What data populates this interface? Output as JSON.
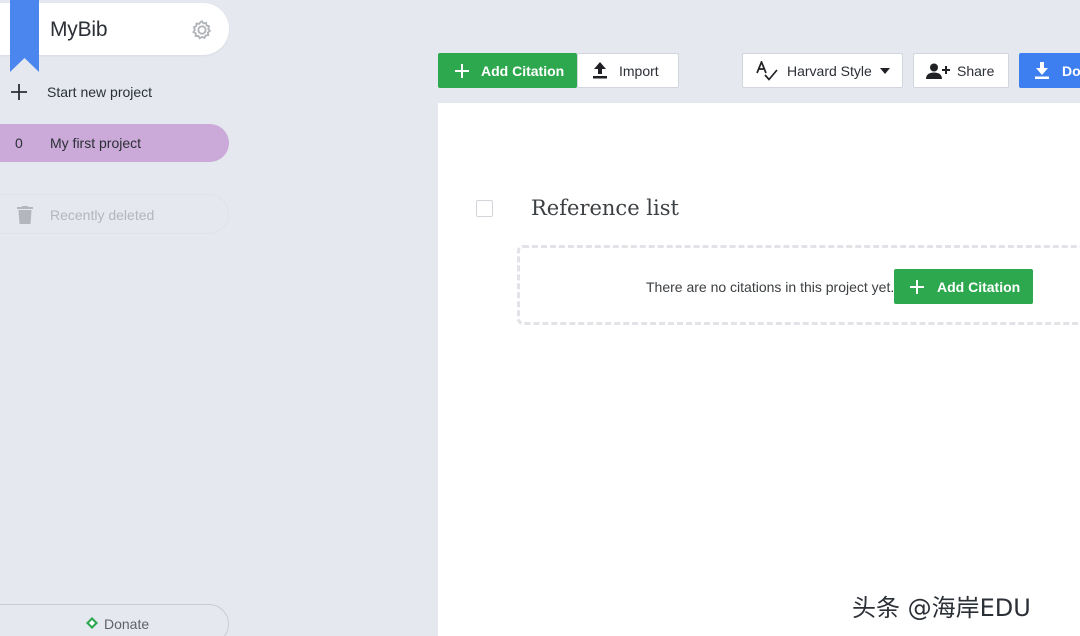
{
  "app": {
    "name": "MyBib"
  },
  "sidebar": {
    "new_project_label": "Start new project",
    "projects": [
      {
        "count": "0",
        "name": "My first project",
        "selected": true,
        "color": "#cba9d8"
      }
    ],
    "recently_deleted_label": "Recently deleted",
    "donate_label": "Donate"
  },
  "toolbar": {
    "add_citation_label": "Add Citation",
    "import_label": "Import",
    "style_label": "Harvard Style",
    "share_label": "Share",
    "download_label": "Do"
  },
  "main": {
    "title": "Reference list",
    "empty_message": "There are no citations in this project yet.",
    "add_citation_label": "Add Citation"
  },
  "watermark": "头条 @海岸EDU",
  "colors": {
    "background": "#e5e8ef",
    "accent_green": "#2ea84f",
    "accent_blue": "#3d7ff0",
    "bookmark_blue": "#4a86ee",
    "project_highlight": "#cba9d8"
  },
  "icons": {
    "brand": "bookmark-icon",
    "settings": "gear-icon",
    "new_project": "plus-icon",
    "trash": "trash-icon",
    "donate": "donate-icon",
    "add": "plus-icon",
    "import": "upload-icon",
    "style": "spellcheck-icon",
    "dropdown": "caret-down-icon",
    "share": "person-add-icon",
    "download": "download-icon"
  }
}
